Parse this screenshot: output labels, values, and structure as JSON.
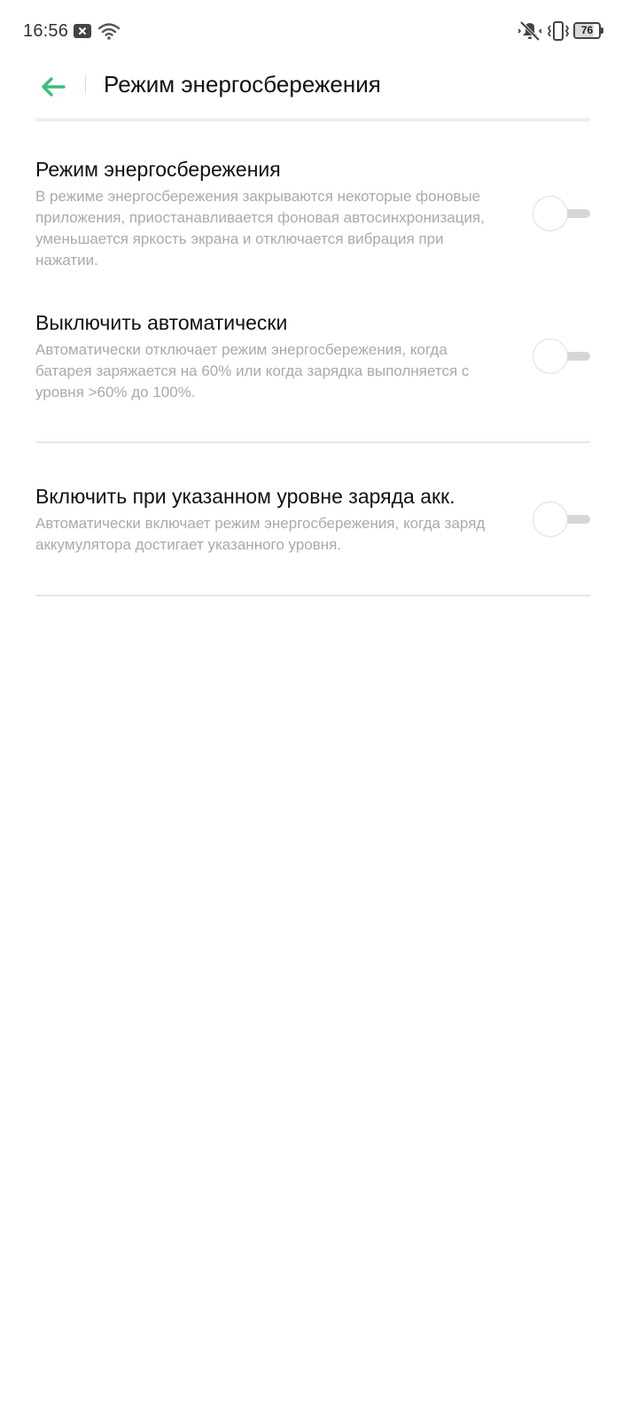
{
  "status_bar": {
    "time": "16:56",
    "battery_level": "76",
    "icons": [
      "notification-x-icon",
      "wifi-icon",
      "mute-icon",
      "vibrate-icon",
      "battery-icon"
    ]
  },
  "header": {
    "title": "Режим энергосбережения",
    "back_icon": "arrow-left-icon",
    "accent_color": "#3dbd7d"
  },
  "settings": [
    {
      "title": "Режим энергосбережения",
      "description": "В режиме энергосбережения закрываются некоторые фоновые приложения, приостанавливается фоновая автосинхронизация, уменьшается яркость экрана и отключается вибрация при нажатии.",
      "enabled": false
    },
    {
      "title": "Выключить автоматически",
      "description": "Автоматически отключает режим энергосбережения, когда батарея заряжается на 60% или когда зарядка выполняется с уровня >60% до 100%.",
      "enabled": false
    },
    {
      "title": "Включить при указанном уровне заряда акк.",
      "description": "Автоматически включает режим энергосбережения, когда заряд аккумулятора достигает указанного уровня.",
      "enabled": false
    }
  ]
}
